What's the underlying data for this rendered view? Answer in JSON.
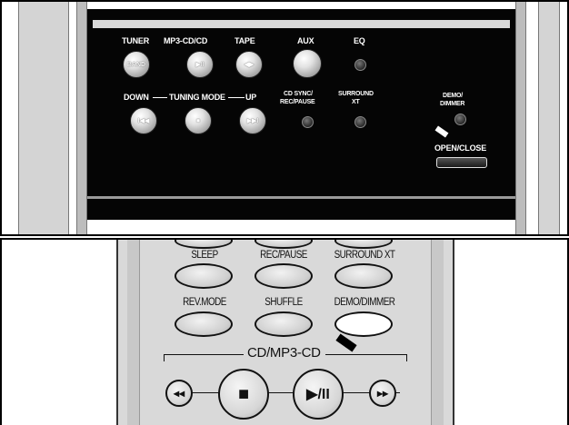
{
  "main_unit": {
    "buttons": {
      "tuner": {
        "label": "TUNER",
        "sub": "BAND"
      },
      "mp3cd": {
        "label": "MP3-CD/CD",
        "icon": "play-pause"
      },
      "tape": {
        "label": "TAPE",
        "icon": "play-reverse"
      },
      "aux": {
        "label": "AUX"
      },
      "eq": {
        "label": "EQ"
      },
      "down": {
        "label": "DOWN",
        "icon": "skip-back"
      },
      "tuning_mode": {
        "label": "TUNING MODE",
        "icon": "stop"
      },
      "up": {
        "label": "UP",
        "icon": "skip-forward"
      },
      "cd_sync": {
        "label_line1": "CD SYNC/",
        "label_line2": "REC/PAUSE"
      },
      "surround": {
        "label_line1": "SURROUND",
        "label_line2": "XT"
      },
      "demo": {
        "label_line1": "DEMO/",
        "label_line2": "DIMMER"
      },
      "open_close": {
        "label": "OPEN/CLOSE"
      }
    }
  },
  "remote": {
    "row1": [
      "SLEEP",
      "REC/PAUSE",
      "SURROUND XT"
    ],
    "row2": [
      "REV.MODE",
      "SHUFFLE",
      "DEMO/DIMMER"
    ],
    "group_label": "CD/MP3-CD",
    "transport": {
      "prev": "◂◂",
      "stop": "■",
      "play": "▶/II",
      "next": "▸▸"
    }
  }
}
